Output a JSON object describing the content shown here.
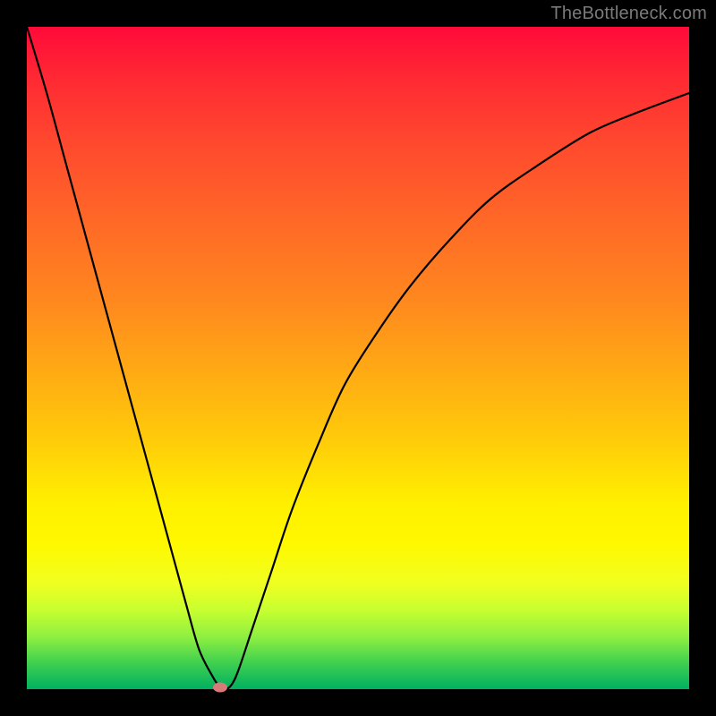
{
  "watermark": "TheBottleneck.com",
  "chart_data": {
    "type": "line",
    "title": "",
    "xlabel": "",
    "ylabel": "",
    "xlim": [
      0,
      100
    ],
    "ylim": [
      0,
      100
    ],
    "background": {
      "type": "vertical-gradient",
      "stops": [
        {
          "pos": 0,
          "color": "#ff0a3a"
        },
        {
          "pos": 50,
          "color": "#ffaa14"
        },
        {
          "pos": 75,
          "color": "#fff000"
        },
        {
          "pos": 100,
          "color": "#00b060"
        }
      ]
    },
    "series": [
      {
        "name": "curve",
        "x": [
          0,
          3,
          6,
          9,
          12,
          15,
          18,
          21,
          24,
          26,
          28,
          29,
          30,
          31,
          32,
          34,
          37,
          40,
          44,
          48,
          53,
          58,
          64,
          70,
          77,
          85,
          92,
          100
        ],
        "y": [
          100,
          90,
          79,
          68,
          57,
          46,
          35,
          24,
          13,
          6,
          2,
          0.5,
          0,
          0.8,
          3,
          9,
          18,
          27,
          37,
          46,
          54,
          61,
          68,
          74,
          79,
          84,
          87,
          90
        ]
      }
    ],
    "marker": {
      "x": 29.2,
      "y": 0.3,
      "color": "#d87a7a"
    }
  }
}
